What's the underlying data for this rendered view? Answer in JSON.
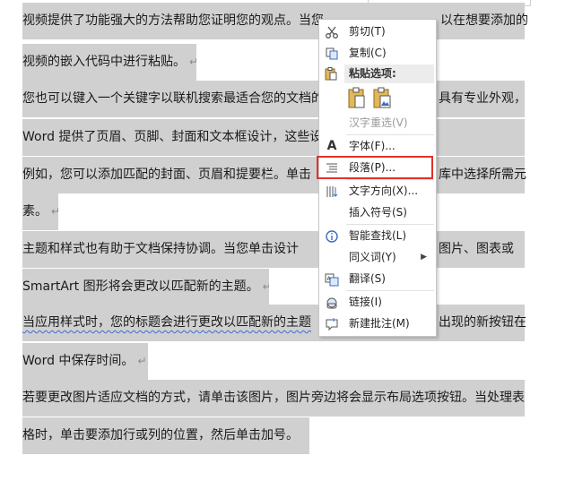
{
  "document": {
    "lines": [
      "视频提供了功能强大的方法帮助您证明您的观点。当您",
      "以在想要添加的",
      "视频的嵌入代码中进行粘贴。",
      "您也可以键入一个关键字以联机搜索最适合您的文档的",
      "具有专业外观，",
      "Word  提供了页眉、页脚、封面和文本框设计，这些设",
      "例如，您可以添加匹配的封面、页眉和提要栏。单击",
      "库中选择所需元",
      "素。",
      "主题和样式也有助于文档保持协调。当您单击设计",
      "图片、图表或",
      "SmartArt  图形将会更改以匹配新的主题。",
      "当应用样式时，您的标题会进行更改以匹配新的主题",
      "出现的新按钮在",
      "Word  中保存时间。",
      "若要更改图片适应文档的方式，请单击该图片，图片旁边将会显示布局选项按钮。当处理表",
      "格时，单击要添加行或列的位置，然后单击加号。"
    ],
    "paragraph_mark": "↵"
  },
  "menu": {
    "cut": {
      "label": "剪切(T)",
      "icon": "scissors-icon"
    },
    "copy": {
      "label": "复制(C)",
      "icon": "copy-icon"
    },
    "paste_header": {
      "label": "粘贴选项:",
      "icon": "clipboard-icon"
    },
    "paste_options": [
      {
        "icon": "paste-keep-formatting-icon"
      },
      {
        "icon": "paste-picture-icon"
      }
    ],
    "hanzi": {
      "label": "汉字重选(V)",
      "disabled": true
    },
    "font": {
      "label": "字体(F)...",
      "icon": "font-icon"
    },
    "paragraph": {
      "label": "段落(P)...",
      "icon": "paragraph-icon",
      "highlighted": true,
      "highlight_color": "#e0332a"
    },
    "text_direction": {
      "label": "文字方向(X)...",
      "icon": "text-direction-icon"
    },
    "insert_symbol": {
      "label": "插入符号(S)"
    },
    "smart_lookup": {
      "label": "智能查找(L)",
      "icon": "smart-lookup-icon"
    },
    "synonyms": {
      "label": "同义词(Y)",
      "has_submenu": true
    },
    "translate": {
      "label": "翻译(S)",
      "icon": "translate-icon"
    },
    "link": {
      "label": "链接(I)",
      "icon": "link-icon"
    },
    "new_comment": {
      "label": "新建批注(M)",
      "icon": "new-comment-icon"
    }
  },
  "colors": {
    "selection": "#d0d0d0",
    "highlight_border": "#e0332a"
  }
}
